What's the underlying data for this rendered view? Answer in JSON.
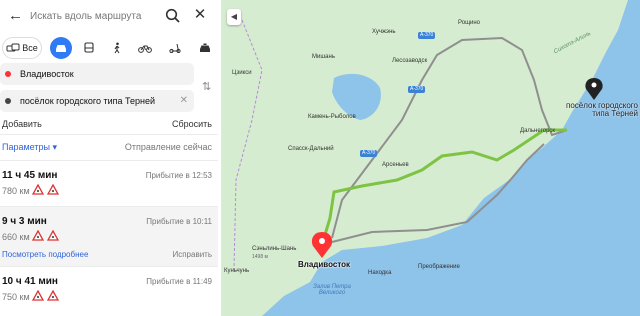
{
  "search": {
    "placeholder": "Искать вдоль маршрута"
  },
  "modes": {
    "all_label": "Все"
  },
  "route_from": "Владивосток",
  "route_to": "посёлок городского типа Терней",
  "actions": {
    "add": "Добавить",
    "reset": "Сбросить"
  },
  "params": {
    "label": "Параметры",
    "departure": "Отправление сейчас"
  },
  "routes": [
    {
      "duration": "11 ч 45 мин",
      "arrival": "Прибытие в 12:53",
      "distance": "780 км"
    },
    {
      "duration": "9 ч 3 мин",
      "arrival": "Прибытие в 10:11",
      "distance": "660 км",
      "details": "Посмотреть подробнее",
      "fix": "Исправить"
    },
    {
      "duration": "10 ч 41 мин",
      "arrival": "Прибытие в 11:49",
      "distance": "750 км"
    }
  ],
  "map": {
    "places": {
      "roshchino": "Рощино",
      "khuchzhin": "Хучжэнь",
      "lesozavodsk": "Лесозаводск",
      "mishan": "Мишань",
      "jixi": "Цзикси",
      "kamen": "Камень-Рыболов",
      "spassk": "Спасск-Дальний",
      "arsenyev": "Арсеньев",
      "dalnegorsk": "Дальнегорск",
      "senlin": "Сэньлинь-Шань",
      "senlin_height": "1498 м",
      "vladivostok": "Владивосток",
      "nakhodka": "Находка",
      "preobrazhenie": "Преображение",
      "kunchun": "Куньчунь",
      "gulf": "Залив Петра Великого",
      "terney": "посёлок городского типа Терней",
      "sikhote": "Сихотэ-Алинь"
    },
    "highways": {
      "a370_top": "A-370",
      "a370_mid": "A-370",
      "a370_low": "A-370"
    },
    "colors": {
      "land": "#d6ecd0",
      "water": "#8ec3ea",
      "route_active": "#7dc344",
      "route_alt": "#8f8f8f",
      "marker_red": "#f33"
    }
  }
}
